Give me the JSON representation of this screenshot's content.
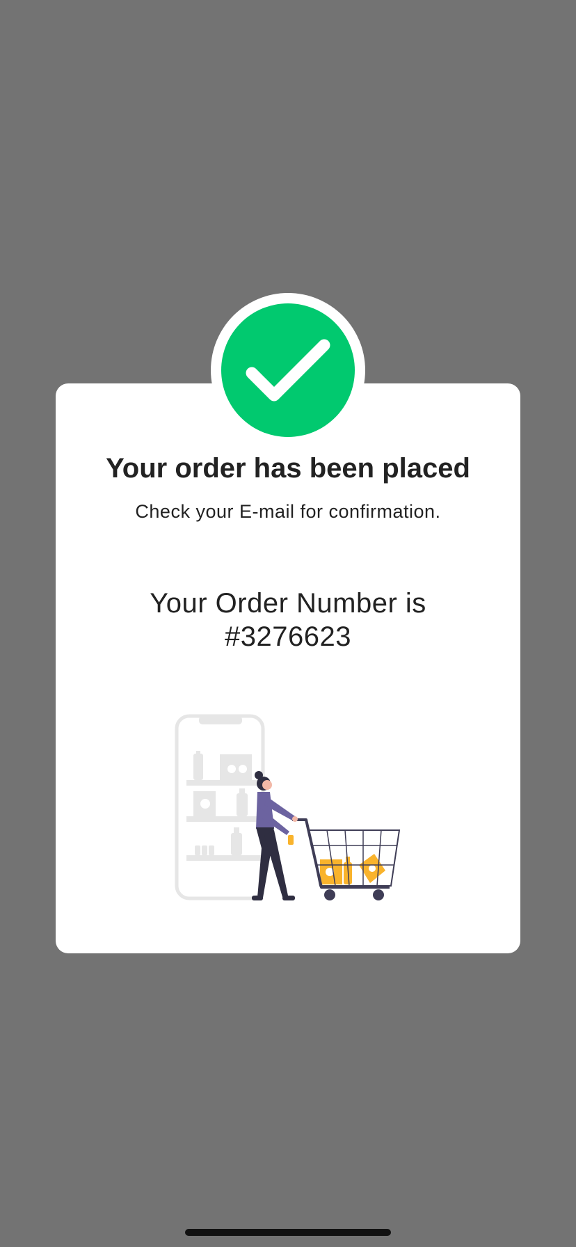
{
  "confirmation": {
    "title": "Your order has been placed",
    "subtitle": "Check your E-mail for confirmation.",
    "order_label": "Your Order Number is",
    "order_number": "#3276623"
  },
  "icons": {
    "status": "checkmark-circle-icon",
    "illustration": "shopping-cart-illustration"
  },
  "colors": {
    "backdrop": "#737373",
    "card": "#ffffff",
    "success": "#01c96f",
    "text": "#222222",
    "accent_items": "#f9b32c",
    "figure_shirt": "#6c63a0",
    "figure_dark": "#2f2e41"
  }
}
